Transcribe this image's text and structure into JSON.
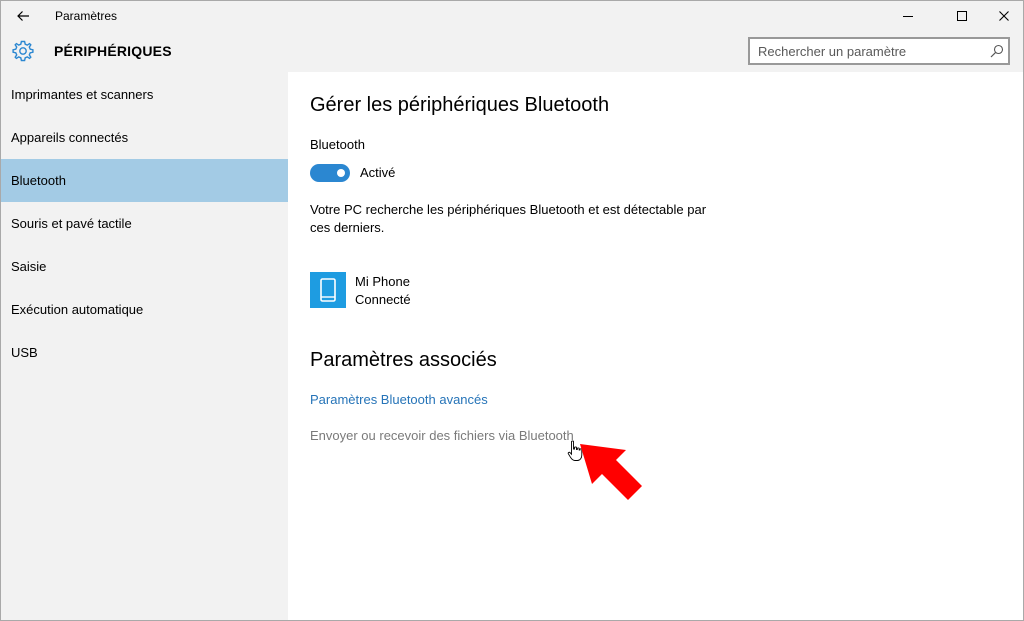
{
  "window": {
    "title": "Paramètres"
  },
  "header": {
    "title": "PÉRIPHÉRIQUES",
    "search_placeholder": "Rechercher un paramètre"
  },
  "sidebar": {
    "items": [
      {
        "label": "Imprimantes et scanners"
      },
      {
        "label": "Appareils connectés"
      },
      {
        "label": "Bluetooth"
      },
      {
        "label": "Souris et pavé tactile"
      },
      {
        "label": "Saisie"
      },
      {
        "label": "Exécution automatique"
      },
      {
        "label": "USB"
      }
    ],
    "selected_index": 2
  },
  "main": {
    "title": "Gérer les périphériques Bluetooth",
    "bluetooth_label": "Bluetooth",
    "toggle_state": "Activé",
    "toggle_on": true,
    "description": "Votre PC recherche les périphériques Bluetooth et est détectable par ces derniers.",
    "device": {
      "name": "Mi Phone",
      "status": "Connecté",
      "icon": "phone-icon"
    },
    "related_title": "Paramètres associés",
    "links": {
      "advanced": "Paramètres Bluetooth avancés",
      "send_receive": "Envoyer ou recevoir des fichiers via Bluetooth"
    }
  },
  "colors": {
    "accent": "#2b87d1",
    "selected_bg": "#a3cbe5",
    "link": "#2674b8",
    "device_tile": "#1e9ce1",
    "annotation_arrow": "#ff0000"
  }
}
